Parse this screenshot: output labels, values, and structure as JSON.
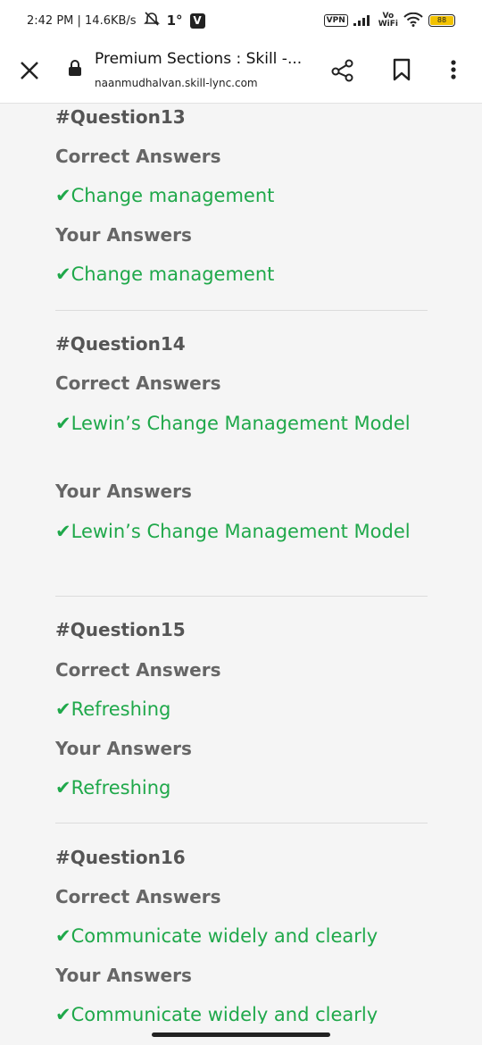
{
  "status_bar": {
    "time_speed": "2:42 PM | 14.6KB/s",
    "temp": "1°",
    "v_badge": "V",
    "vpn": "VPN",
    "vo": "Vo",
    "wifi_label": "WiFi",
    "battery": "88"
  },
  "toolbar": {
    "title": "Premium Sections : Skill -...",
    "url": "naanmudhalvan.skill-lync.com"
  },
  "questions": [
    {
      "title": "#Question13",
      "correct_label": "Correct Answers",
      "correct": "Change management",
      "your_label": "Your Answers",
      "yours": "Change management"
    },
    {
      "title": "#Question14",
      "correct_label": "Correct Answers",
      "correct": "Lewin’s Change Management Model",
      "your_label": "Your Answers",
      "yours": "Lewin’s Change Management Model"
    },
    {
      "title": "#Question15",
      "correct_label": "Correct Answers",
      "correct": "Refreshing",
      "your_label": "Your Answers",
      "yours": "Refreshing"
    },
    {
      "title": "#Question16",
      "correct_label": "Correct Answers",
      "correct": "Communicate widely and clearly",
      "your_label": "Your Answers",
      "yours": "Communicate widely and clearly"
    }
  ],
  "colors": {
    "answer_green": "#1fa84a",
    "label_gray": "#666666"
  }
}
